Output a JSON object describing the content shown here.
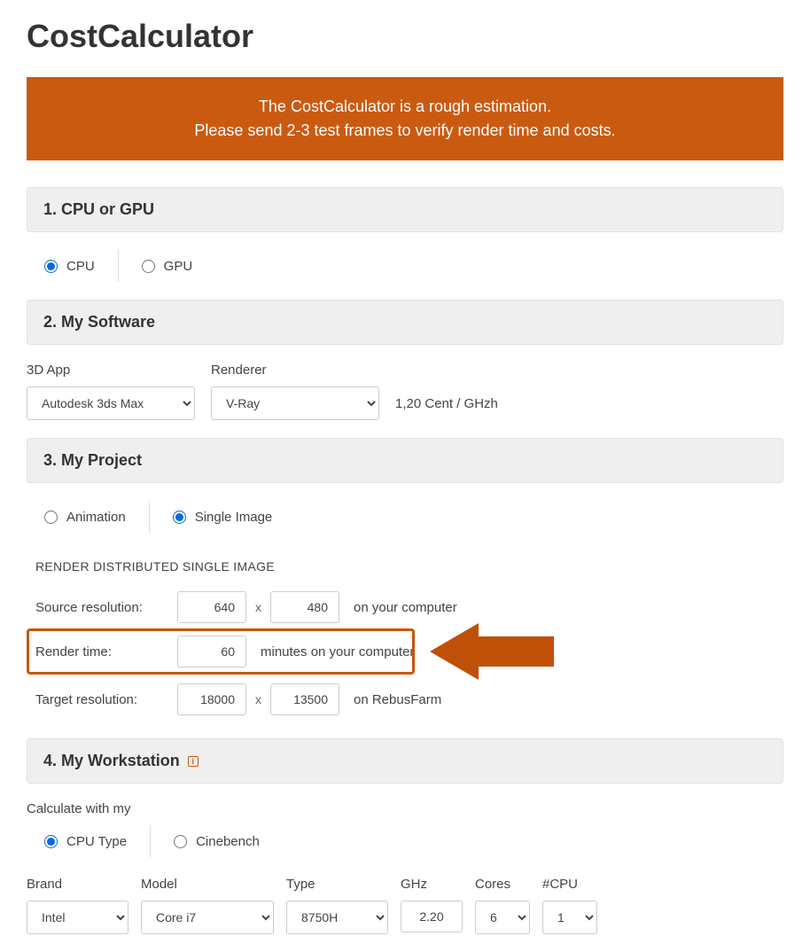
{
  "title": "CostCalculator",
  "banner": {
    "line1": "The CostCalculator is a rough estimation.",
    "line2": "Please send 2-3 test frames to verify render time and costs."
  },
  "sections": {
    "s1": {
      "title": "1. CPU or GPU",
      "options": {
        "cpu": "CPU",
        "gpu": "GPU"
      }
    },
    "s2": {
      "title": "2. My Software",
      "app_label": "3D App",
      "renderer_label": "Renderer",
      "app_value": "Autodesk 3ds Max",
      "renderer_value": "V-Ray",
      "price": "1,20 Cent / GHzh"
    },
    "s3": {
      "title": "3. My Project",
      "options": {
        "animation": "Animation",
        "single": "Single Image"
      },
      "subheading": "RENDER DISTRIBUTED SINGLE IMAGE",
      "rows": {
        "source": {
          "label": "Source resolution:",
          "w": "640",
          "h": "480",
          "suffix": "on your computer"
        },
        "render": {
          "label": "Render time:",
          "v": "60",
          "suffix": "minutes on your computer"
        },
        "target": {
          "label": "Target resolution:",
          "w": "18000",
          "h": "13500",
          "suffix": "on RebusFarm"
        }
      },
      "x": "x"
    },
    "s4": {
      "title": "4. My Workstation",
      "calc_label": "Calculate with my",
      "options": {
        "cputype": "CPU Type",
        "cinebench": "Cinebench"
      },
      "cols": {
        "brand": {
          "label": "Brand",
          "value": "Intel"
        },
        "model": {
          "label": "Model",
          "value": "Core i7"
        },
        "type": {
          "label": "Type",
          "value": "8750H"
        },
        "ghz": {
          "label": "GHz",
          "value": "2.20"
        },
        "cores": {
          "label": "Cores",
          "value": "6"
        },
        "ncpu": {
          "label": "#CPU",
          "value": "1"
        }
      }
    }
  }
}
